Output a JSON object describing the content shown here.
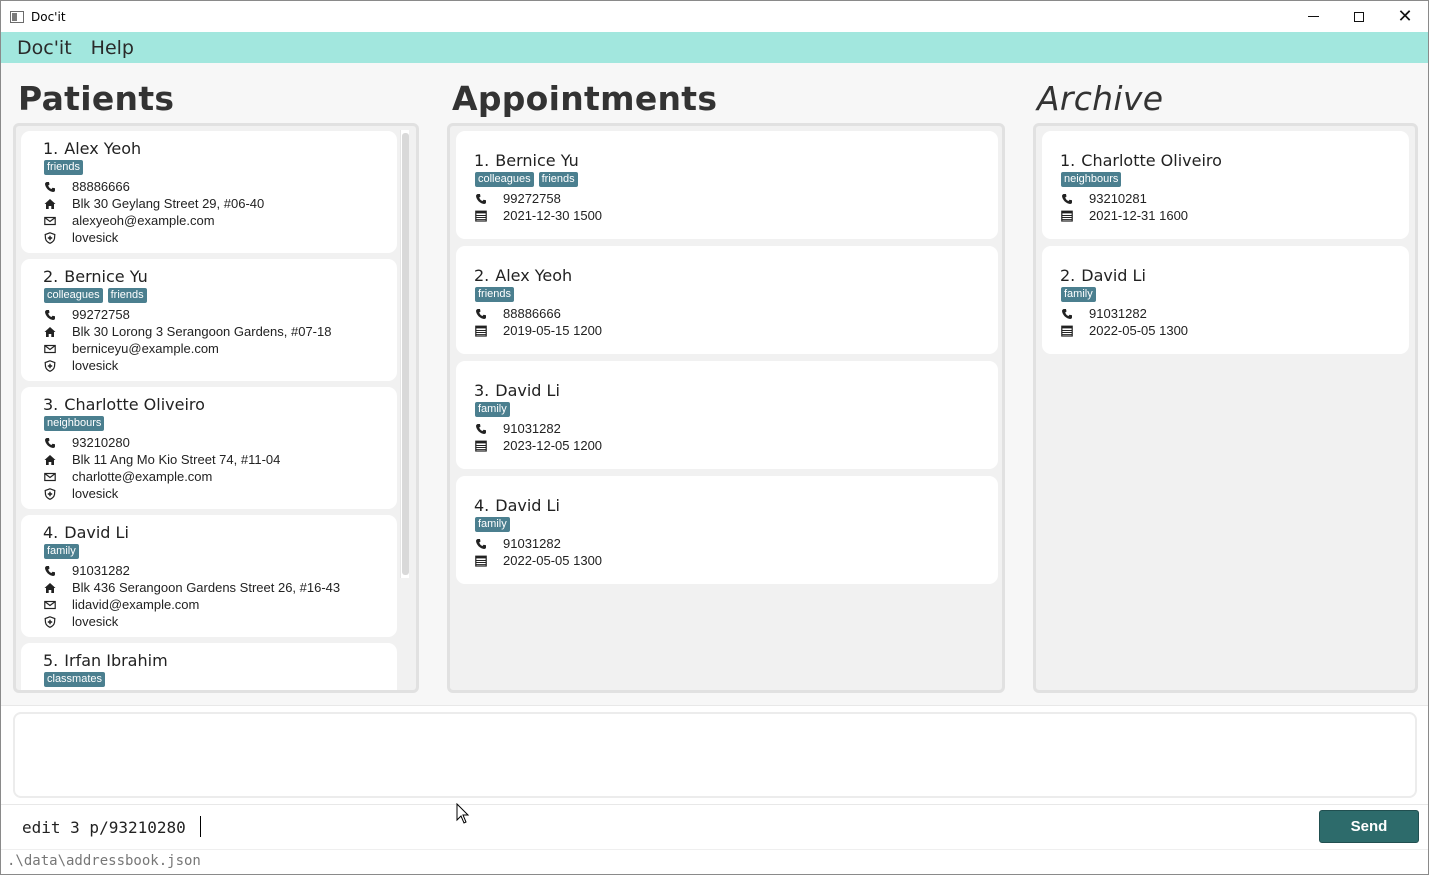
{
  "window": {
    "title": "Doc'it"
  },
  "menu": {
    "items": [
      "Doc'it",
      "Help"
    ]
  },
  "sections": {
    "patients": "Patients",
    "appointments": "Appointments",
    "archive": "Archive"
  },
  "patients": [
    {
      "index": "1.",
      "name": "Alex Yeoh",
      "tags": [
        "friends"
      ],
      "phone": "88886666",
      "address": "Blk 30 Geylang Street 29, #06-40",
      "email": "alexyeoh@example.com",
      "medical": "lovesick"
    },
    {
      "index": "2.",
      "name": "Bernice Yu",
      "tags": [
        "colleagues",
        "friends"
      ],
      "phone": "99272758",
      "address": "Blk 30 Lorong 3 Serangoon Gardens, #07-18",
      "email": "berniceyu@example.com",
      "medical": "lovesick"
    },
    {
      "index": "3.",
      "name": "Charlotte Oliveiro",
      "tags": [
        "neighbours"
      ],
      "phone": "93210280",
      "address": "Blk 11 Ang Mo Kio Street 74, #11-04",
      "email": "charlotte@example.com",
      "medical": "lovesick"
    },
    {
      "index": "4.",
      "name": "David Li",
      "tags": [
        "family"
      ],
      "phone": "91031282",
      "address": "Blk 436 Serangoon Gardens Street 26, #16-43",
      "email": "lidavid@example.com",
      "medical": "lovesick"
    },
    {
      "index": "5.",
      "name": "Irfan Ibrahim",
      "tags": [
        "classmates"
      ]
    }
  ],
  "appointments": [
    {
      "index": "1.",
      "name": "Bernice Yu",
      "tags": [
        "colleagues",
        "friends"
      ],
      "phone": "99272758",
      "datetime": "2021-12-30 1500"
    },
    {
      "index": "2.",
      "name": "Alex Yeoh",
      "tags": [
        "friends"
      ],
      "phone": "88886666",
      "datetime": "2019-05-15 1200"
    },
    {
      "index": "3.",
      "name": "David Li",
      "tags": [
        "family"
      ],
      "phone": "91031282",
      "datetime": "2023-12-05 1200"
    },
    {
      "index": "4.",
      "name": "David Li",
      "tags": [
        "family"
      ],
      "phone": "91031282",
      "datetime": "2022-05-05 1300"
    }
  ],
  "archive": [
    {
      "index": "1.",
      "name": "Charlotte Oliveiro",
      "tags": [
        "neighbours"
      ],
      "phone": "93210281",
      "datetime": "2021-12-31 1600"
    },
    {
      "index": "2.",
      "name": "David Li",
      "tags": [
        "family"
      ],
      "phone": "91031282",
      "datetime": "2022-05-05 1300"
    }
  ],
  "result": {
    "text": ""
  },
  "command": {
    "value": "edit 3 p/93210280",
    "send_label": "Send"
  },
  "status": {
    "path": ".\\data\\addressbook.json"
  },
  "colors": {
    "menubar": "#a2e7de",
    "tag": "#4b7f8f",
    "send": "#2d6b6b"
  },
  "icons": {
    "phone": "phone-icon",
    "address": "home-icon",
    "email": "email-icon",
    "medical": "medical-icon",
    "date": "calendar-icon"
  }
}
